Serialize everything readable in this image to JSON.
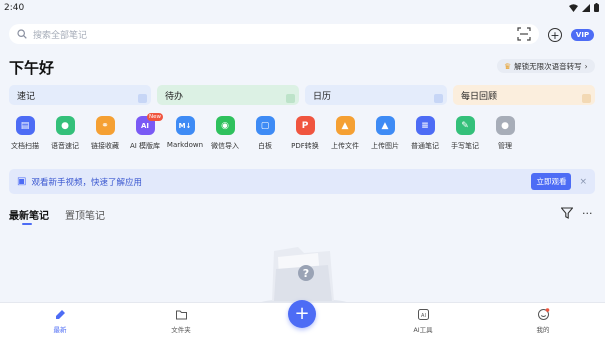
{
  "status": {
    "time": "2:40"
  },
  "search": {
    "placeholder": "搜索全部笔记"
  },
  "header": {
    "vip_label": "VIP",
    "greeting": "下午好",
    "promo": "解锁无限次语音转写"
  },
  "cards": [
    {
      "label": "速记",
      "bg": "#e4ecfb",
      "deco": "#c7d6f6"
    },
    {
      "label": "待办",
      "bg": "#dcf1e4",
      "deco": "#bde3c9"
    },
    {
      "label": "日历",
      "bg": "#e4ecfb",
      "deco": "#c7d6f6"
    },
    {
      "label": "每日回顾",
      "bg": "#fbeedd",
      "deco": "#f3d9b4"
    }
  ],
  "tools": [
    {
      "label": "文档扫描",
      "icon": "scan-doc-icon",
      "color": "#4d6cf5"
    },
    {
      "label": "语音速记",
      "icon": "microphone-icon",
      "color": "#34c07a"
    },
    {
      "label": "链接收藏",
      "icon": "link-icon",
      "color": "#f5a033"
    },
    {
      "label": "AI 模版库",
      "icon": "ai-template-icon",
      "color": "#7a5af5",
      "badge": "New"
    },
    {
      "label": "Markdown",
      "icon": "markdown-icon",
      "color": "#3e8bf5"
    },
    {
      "label": "微信导入",
      "icon": "wechat-icon",
      "color": "#2fc15d"
    },
    {
      "label": "白板",
      "icon": "whiteboard-icon",
      "color": "#3e8bf5"
    },
    {
      "label": "PDF转换",
      "icon": "pdf-icon",
      "color": "#f0553f"
    },
    {
      "label": "上传文件",
      "icon": "upload-file-icon",
      "color": "#f5a033"
    },
    {
      "label": "上传图片",
      "icon": "upload-image-icon",
      "color": "#3e8bf5"
    },
    {
      "label": "普通笔记",
      "icon": "note-icon",
      "color": "#4d6cf5"
    },
    {
      "label": "手写笔记",
      "icon": "handwrite-icon",
      "color": "#34c07a"
    },
    {
      "label": "管理",
      "icon": "manage-icon",
      "color": "#a7adb8"
    }
  ],
  "banner": {
    "text": "观看新手视频，快速了解应用",
    "button": "立即观看",
    "close": "×"
  },
  "tabs": [
    {
      "label": "最新笔记"
    },
    {
      "label": "置顶笔记"
    }
  ],
  "bottom_nav": [
    {
      "label": "最新",
      "icon": "latest-note-icon"
    },
    {
      "label": "文件夹",
      "icon": "folder-icon"
    },
    {
      "label": "AI工具",
      "icon": "ai-tools-icon"
    },
    {
      "label": "我的",
      "icon": "profile-icon"
    }
  ],
  "colors": {
    "accent": "#4d6cf5",
    "background": "#f2f5fb"
  }
}
